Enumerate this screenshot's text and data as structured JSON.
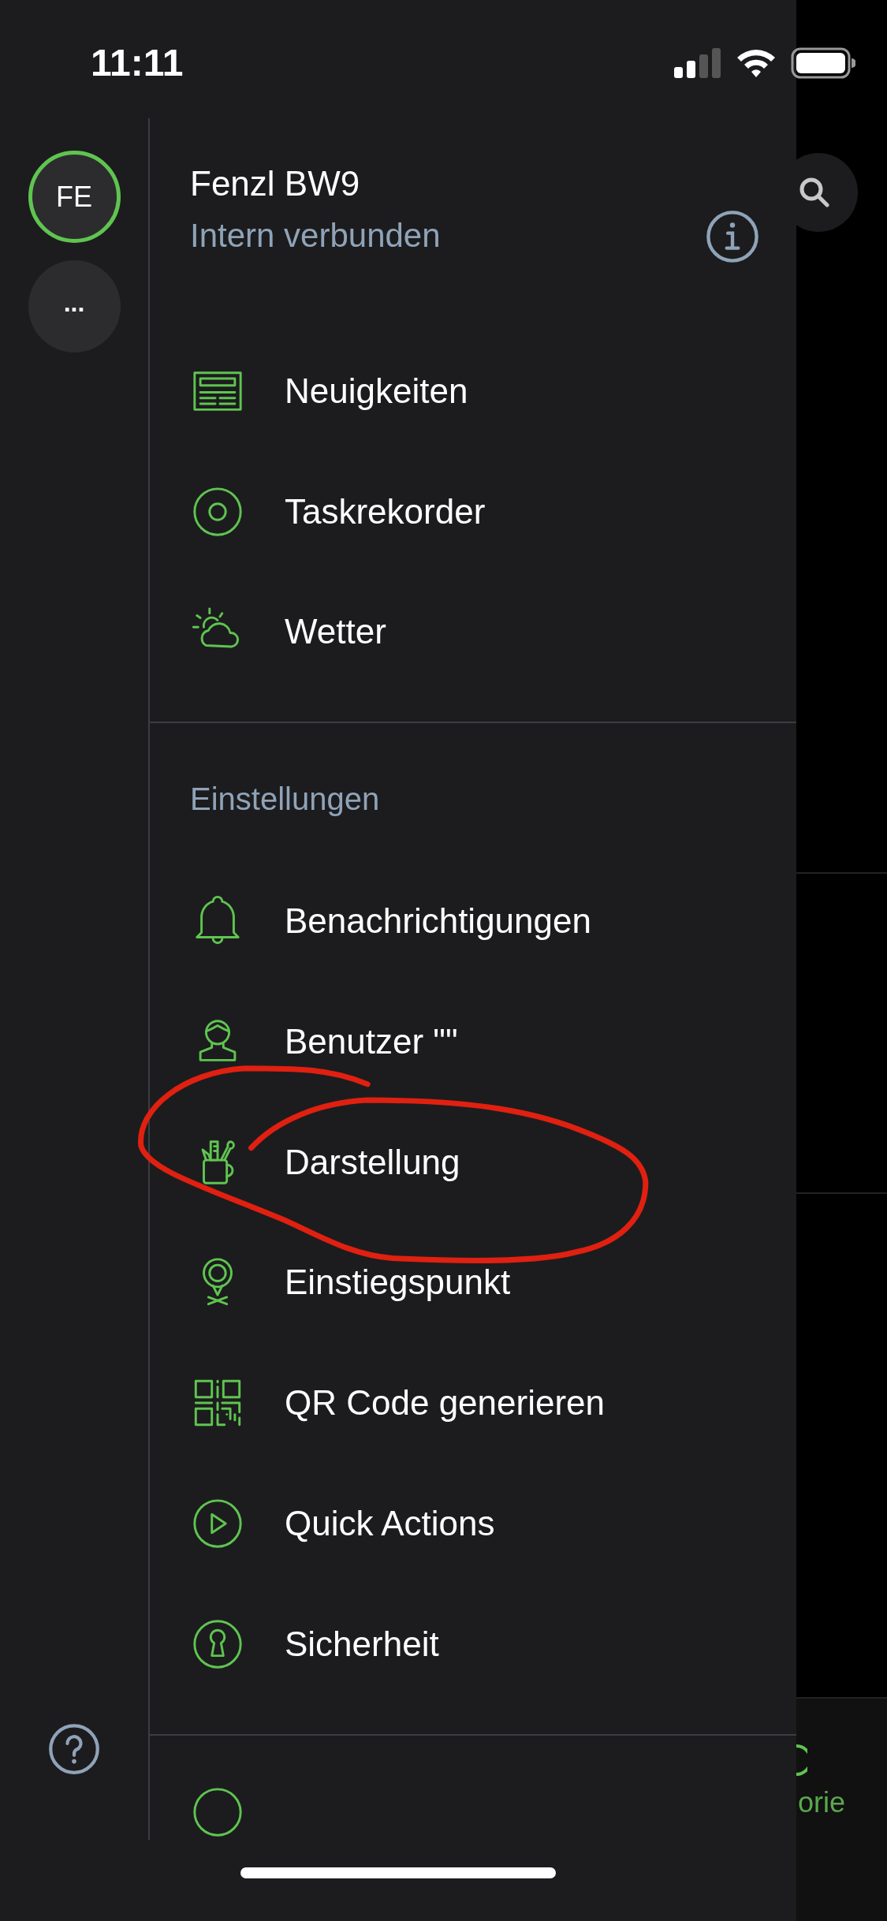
{
  "status_bar": {
    "time": "11:11"
  },
  "rail": {
    "avatar": "FE",
    "more": "..."
  },
  "header": {
    "title": "Fenzl BW9",
    "subtitle": "Intern verbunden"
  },
  "menu_items": [
    {
      "label": "Neuigkeiten"
    },
    {
      "label": "Taskrekorder"
    },
    {
      "label": "Wetter"
    }
  ],
  "settings": {
    "heading": "Einstellungen",
    "items": [
      {
        "label": "Benachrichtigungen"
      },
      {
        "label": "Benutzer \"\""
      },
      {
        "label": "Darstellung"
      },
      {
        "label": "Einstiegspunkt"
      },
      {
        "label": "QR Code generieren"
      },
      {
        "label": "Quick Actions"
      },
      {
        "label": "Sicherheit"
      }
    ]
  },
  "background": {
    "tab_label": "orie"
  }
}
